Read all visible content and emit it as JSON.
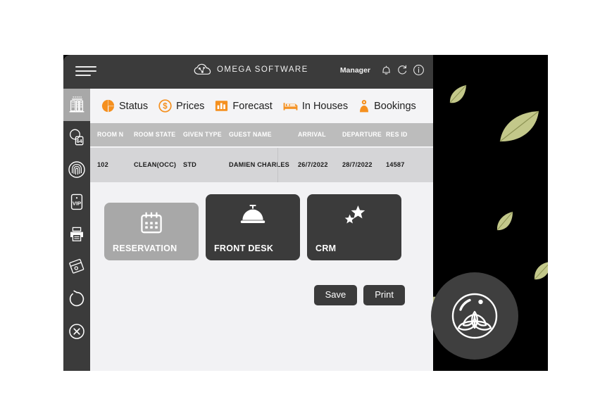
{
  "app": {
    "brand_name": "OMEGA SOFTWARE",
    "brand_icon": "cloud-network-icon",
    "menu_icon": "hamburger-menu-icon",
    "user_role": "Manager",
    "topbar_icons": [
      {
        "name": "notifications-bell-icon",
        "glyph": "bell"
      },
      {
        "name": "refresh-icon",
        "glyph": "refresh"
      },
      {
        "name": "info-icon",
        "glyph": "info"
      }
    ]
  },
  "sidebar": {
    "items": [
      {
        "name": "sidebar-item-hotel",
        "icon": "hotel-building-icon",
        "active": true
      },
      {
        "name": "sidebar-item-room-key",
        "icon": "room-key-tag-icon",
        "badge": "64",
        "active": false
      },
      {
        "name": "sidebar-item-fingerprint",
        "icon": "fingerprint-icon",
        "active": false
      },
      {
        "name": "sidebar-item-vip",
        "icon": "vip-card-icon",
        "label": "VIP",
        "active": false
      },
      {
        "name": "sidebar-item-print",
        "icon": "printer-icon",
        "active": false
      },
      {
        "name": "sidebar-item-cards",
        "icon": "stacked-cards-icon",
        "active": false
      },
      {
        "name": "sidebar-item-refresh",
        "icon": "circular-refresh-icon",
        "active": false
      },
      {
        "name": "sidebar-item-close",
        "icon": "close-x-circle-icon",
        "active": false
      }
    ]
  },
  "nav": {
    "items": [
      {
        "label": "Status",
        "icon": "pie-chart-icon"
      },
      {
        "label": "Prices",
        "icon": "dollar-circle-icon"
      },
      {
        "label": "Forecast",
        "icon": "bar-chart-icon"
      },
      {
        "label": "In Houses",
        "icon": "bed-icon"
      },
      {
        "label": "Bookings",
        "icon": "person-pin-icon"
      }
    ]
  },
  "table": {
    "columns": [
      "ROOM N",
      "ROOM STATE",
      "GIVEN TYPE",
      "GUEST NAME",
      "ARRIVAL",
      "DEPARTURE",
      "RES ID"
    ],
    "rows": [
      {
        "room_n": "102",
        "room_state": "CLEAN(OCC)",
        "given_type": "STD",
        "guest_name": "DAMIEN CHARLES",
        "arrival": "26/7/2022",
        "departure": "28/7/2022",
        "res_id": "14587"
      }
    ]
  },
  "cards": [
    {
      "label": "RESERVATION",
      "icon": "calendar-icon",
      "selected": true
    },
    {
      "label": "FRONT DESK",
      "icon": "service-bell-icon",
      "selected": false
    },
    {
      "label": "CRM",
      "icon": "stars-icon",
      "selected": false
    }
  ],
  "actions": [
    {
      "label": "Save",
      "name": "save-button"
    },
    {
      "label": "Print",
      "name": "print-button"
    }
  ],
  "branding": {
    "badge_icon": "lotus-flower-logo"
  },
  "colors": {
    "accent_orange": "#f5901f",
    "dark_chrome": "#3b3b3b",
    "panel_bg": "#f2f2f4",
    "table_head": "#bcbcbc",
    "table_row": "#d5d5d7",
    "selected_gray": "#a8a8a8",
    "leaf_green": "#c3c88a"
  }
}
